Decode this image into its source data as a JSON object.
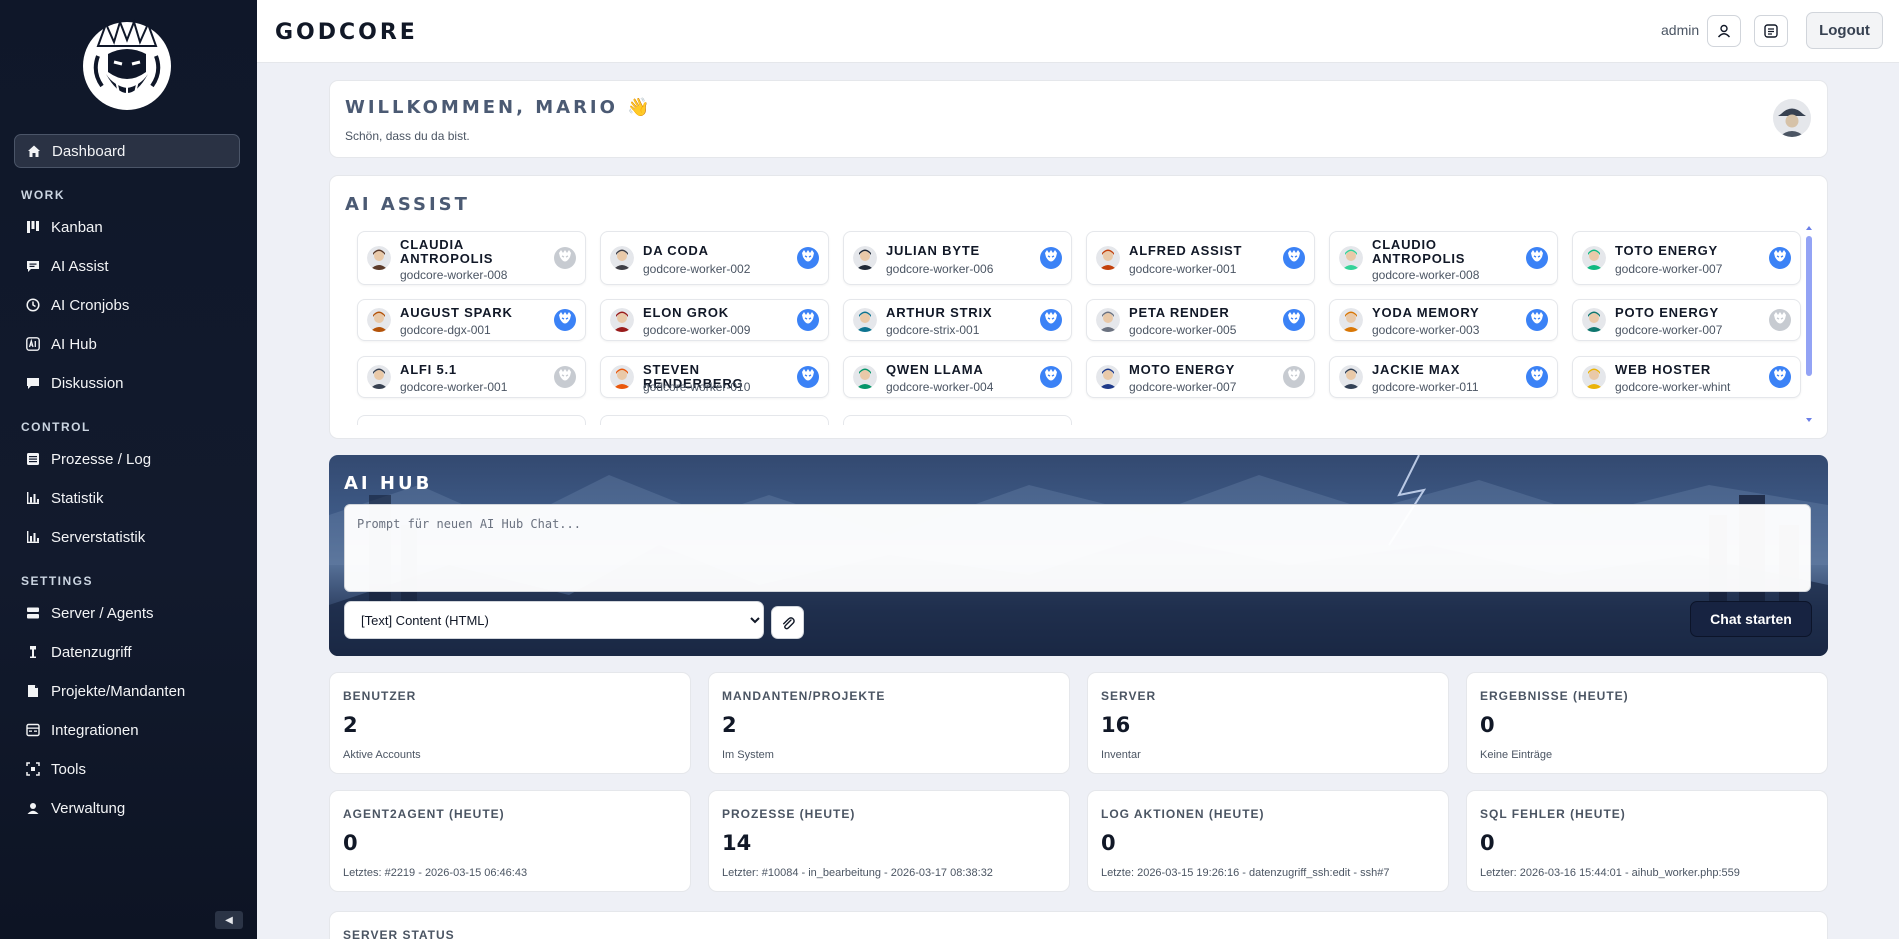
{
  "sidebar": {
    "items": {
      "dashboard": "Dashboard",
      "kanban": "Kanban",
      "ai_assist": "AI Assist",
      "ai_cronjobs": "AI Cronjobs",
      "ai_hub": "AI Hub",
      "diskussion": "Diskussion",
      "prozesse_log": "Prozesse / Log",
      "statistik": "Statistik",
      "serverstatistik": "Serverstatistik",
      "server_agents": "Server / Agents",
      "datenzugriff": "Datenzugriff",
      "projekte": "Projekte/Mandanten",
      "integrationen": "Integrationen",
      "tools": "Tools",
      "verwaltung": "Verwaltung"
    },
    "sections": {
      "work": "WORK",
      "control": "CONTROL",
      "settings": "SETTINGS"
    },
    "collapse_glyph": "◀"
  },
  "topbar": {
    "brand": "GODCORE",
    "user": "admin",
    "logout": "Logout"
  },
  "welcome": {
    "title": "WILLKOMMEN, MARIO 👋",
    "subtitle": "Schön, dass du da bist."
  },
  "ai_assist": {
    "title": "AI ASSIST",
    "agents": [
      {
        "name": "CLAUDIA ANTROPOLIS",
        "worker": "godcore-worker-008",
        "online": false,
        "color": "#5b3a29"
      },
      {
        "name": "DA CODA",
        "worker": "godcore-worker-002",
        "online": true,
        "color": "#3f3f46"
      },
      {
        "name": "JULIAN BYTE",
        "worker": "godcore-worker-006",
        "online": true,
        "color": "#1f2937"
      },
      {
        "name": "ALFRED ASSIST",
        "worker": "godcore-worker-001",
        "online": true,
        "color": "#c2410c"
      },
      {
        "name": "CLAUDIO ANTROPOLIS",
        "worker": "godcore-worker-008",
        "online": true,
        "color": "#34d399"
      },
      {
        "name": "TOTO ENERGY",
        "worker": "godcore-worker-007",
        "online": true,
        "color": "#10b981"
      },
      {
        "name": "AUGUST SPARK",
        "worker": "godcore-dgx-001",
        "online": true,
        "color": "#b45309"
      },
      {
        "name": "ELON GROK",
        "worker": "godcore-worker-009",
        "online": true,
        "color": "#991b1b"
      },
      {
        "name": "ARTHUR STRIX",
        "worker": "godcore-strix-001",
        "online": true,
        "color": "#0e7490"
      },
      {
        "name": "PETA RENDER",
        "worker": "godcore-worker-005",
        "online": true,
        "color": "#6b7280"
      },
      {
        "name": "YODA MEMORY",
        "worker": "godcore-worker-003",
        "online": true,
        "color": "#d97706"
      },
      {
        "name": "POTO ENERGY",
        "worker": "godcore-worker-007",
        "online": false,
        "color": "#0f766e"
      },
      {
        "name": "ALFI 5.1",
        "worker": "godcore-worker-001",
        "online": false,
        "color": "#374151"
      },
      {
        "name": "STEVEN RENDERBERG",
        "worker": "godcore-worker-010",
        "online": true,
        "color": "#ea580c"
      },
      {
        "name": "QWEN LLAMA",
        "worker": "godcore-worker-004",
        "online": true,
        "color": "#059669"
      },
      {
        "name": "MOTO ENERGY",
        "worker": "godcore-worker-007",
        "online": false,
        "color": "#1e3a8a"
      },
      {
        "name": "JACKIE MAX",
        "worker": "godcore-worker-011",
        "online": true,
        "color": "#334155"
      },
      {
        "name": "WEB HOSTER",
        "worker": "godcore-worker-whint",
        "online": true,
        "color": "#eab308"
      }
    ]
  },
  "ai_hub": {
    "title": "AI HUB",
    "prompt_placeholder": "Prompt für neuen AI Hub Chat...",
    "content_type": "[Text] Content (HTML)",
    "start_button": "Chat starten"
  },
  "stats": [
    {
      "label": "BENUTZER",
      "value": "2",
      "desc": "Aktive Accounts"
    },
    {
      "label": "MANDANTEN/PROJEKTE",
      "value": "2",
      "desc": "Im System"
    },
    {
      "label": "SERVER",
      "value": "16",
      "desc": "Inventar"
    },
    {
      "label": "ERGEBNISSE (HEUTE)",
      "value": "0",
      "desc": "Keine Einträge"
    },
    {
      "label": "AGENT2AGENT (HEUTE)",
      "value": "0",
      "desc": "Letztes: #2219 - 2026-03-15 06:46:43"
    },
    {
      "label": "PROZESSE (HEUTE)",
      "value": "14",
      "desc": "Letzter: #10084 - in_bearbeitung - 2026-03-17 08:38:32"
    },
    {
      "label": "LOG AKTIONEN (HEUTE)",
      "value": "0",
      "desc": "Letzte: 2026-03-15 19:26:16 - datenzugriff_ssh:edit - ssh#7"
    },
    {
      "label": "SQL FEHLER (HEUTE)",
      "value": "0",
      "desc": "Letzter: 2026-03-16 15:44:01 - aihub_worker.php:559"
    }
  ],
  "server_status": {
    "label": "SERVER STATUS"
  },
  "colors": {
    "sidebar_bg": "#0f1729",
    "accent": "#172341",
    "online": "#3b82f6",
    "offline": "#c7cbd1"
  }
}
